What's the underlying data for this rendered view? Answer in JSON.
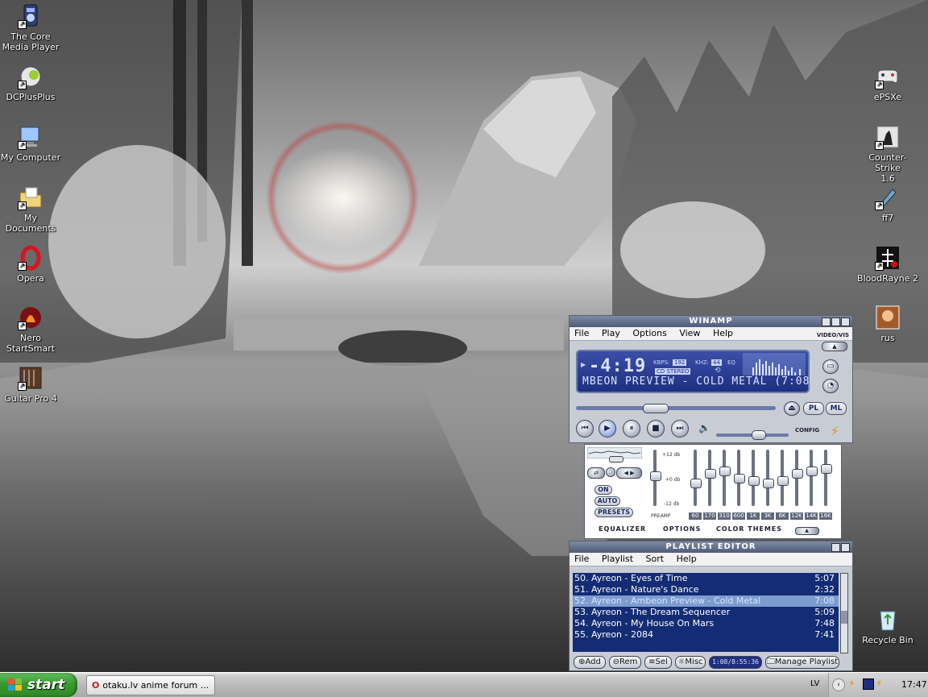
{
  "desktop": {
    "icons_left": [
      {
        "label_line1": "The Core",
        "label_line2": "Media Player",
        "icon": "media-player-icon"
      },
      {
        "label_line1": "DCPlusPlus",
        "label_line2": "",
        "icon": "dcplusplus-icon"
      },
      {
        "label_line1": "My Computer",
        "label_line2": "",
        "icon": "my-computer-icon"
      },
      {
        "label_line1": "My Documents",
        "label_line2": "",
        "icon": "my-documents-icon"
      },
      {
        "label_line1": "Opera",
        "label_line2": "",
        "icon": "opera-icon"
      },
      {
        "label_line1": "Nero",
        "label_line2": "StartSmart",
        "icon": "nero-icon"
      },
      {
        "label_line1": "Guitar Pro 4",
        "label_line2": "",
        "icon": "guitar-pro-icon"
      }
    ],
    "icons_right": [
      {
        "label_line1": "ePSXe",
        "label_line2": "",
        "icon": "gamepad-icon"
      },
      {
        "label_line1": "Counter-Strike",
        "label_line2": "1.6",
        "icon": "counter-strike-icon"
      },
      {
        "label_line1": "ff7",
        "label_line2": "",
        "icon": "ff7-icon"
      },
      {
        "label_line1": "BloodRayne 2",
        "label_line2": "",
        "icon": "bloodrayne-icon"
      },
      {
        "label_line1": "rus",
        "label_line2": "",
        "icon": "rus-icon"
      },
      {
        "label_line1": "Recycle Bin",
        "label_line2": "",
        "icon": "recycle-bin-icon"
      }
    ]
  },
  "winamp": {
    "title": "WINAMP",
    "menu": [
      "File",
      "Play",
      "Options",
      "View",
      "Help"
    ],
    "video_vis_label": "VIDEO/VIS",
    "time": "-4:19",
    "kbps_label": "KBPS:",
    "kbps": "192",
    "khz_label": "KHZ:",
    "khz": "44",
    "eq_label": "EQ",
    "stereo_label": "CD STEREO",
    "marquee": "MBEON PREVIEW - COLD METAL (7:08",
    "pl_label": "PL",
    "ml_label": "ML",
    "config_label": "CONFIG",
    "progress_fraction": 0.38,
    "volume_fraction": 0.6
  },
  "equalizer": {
    "db_top": "+12 db",
    "db_mid": "+0 db",
    "db_bottom": "-12 db",
    "preamp_label": "PREAMP",
    "on_label": "ON",
    "auto_label": "AUTO",
    "presets_label": "PRESETS",
    "bands": [
      "60",
      "170",
      "310",
      "600",
      "1K",
      "3K",
      "6K",
      "12K",
      "14K",
      "16K"
    ],
    "band_levels": [
      0.6,
      0.4,
      0.35,
      0.5,
      0.55,
      0.6,
      0.55,
      0.4,
      0.35,
      0.3
    ],
    "preamp_level": 0.45,
    "tabs": [
      "EQUALIZER",
      "OPTIONS",
      "COLOR THEMES"
    ]
  },
  "playlist": {
    "title": "PLAYLIST EDITOR",
    "menu": [
      "File",
      "Playlist",
      "Sort",
      "Help"
    ],
    "items": [
      {
        "title": "50. Ayreon - Eyes of Time",
        "duration": "5:07"
      },
      {
        "title": "51. Ayreon - Nature's Dance",
        "duration": "2:32"
      },
      {
        "title": "52. Ayreon - Ambeon Preview - Cold Metal",
        "duration": "7:08"
      },
      {
        "title": "53. Ayreon - The Dream Sequencer",
        "duration": "5:09"
      },
      {
        "title": "54. Ayreon - My House On Mars",
        "duration": "7:48"
      },
      {
        "title": "55. Ayreon - 2084",
        "duration": "7:41"
      }
    ],
    "selected_index": 2,
    "buttons": [
      "Add",
      "Rem",
      "Sel",
      "Misc"
    ],
    "total_time": "1:08/8:55:36",
    "manage_label": "Manage Playlist"
  },
  "taskbar": {
    "start_label": "start",
    "task_label": "otaku.lv anime forum ...",
    "language": "LV",
    "clock": "17:47"
  },
  "colors": {
    "winamp_display": "#1f2f80",
    "playlist_bg": "#132c74",
    "playlist_selected": "#7c9ccf",
    "start_green": "#3a9a2f"
  }
}
